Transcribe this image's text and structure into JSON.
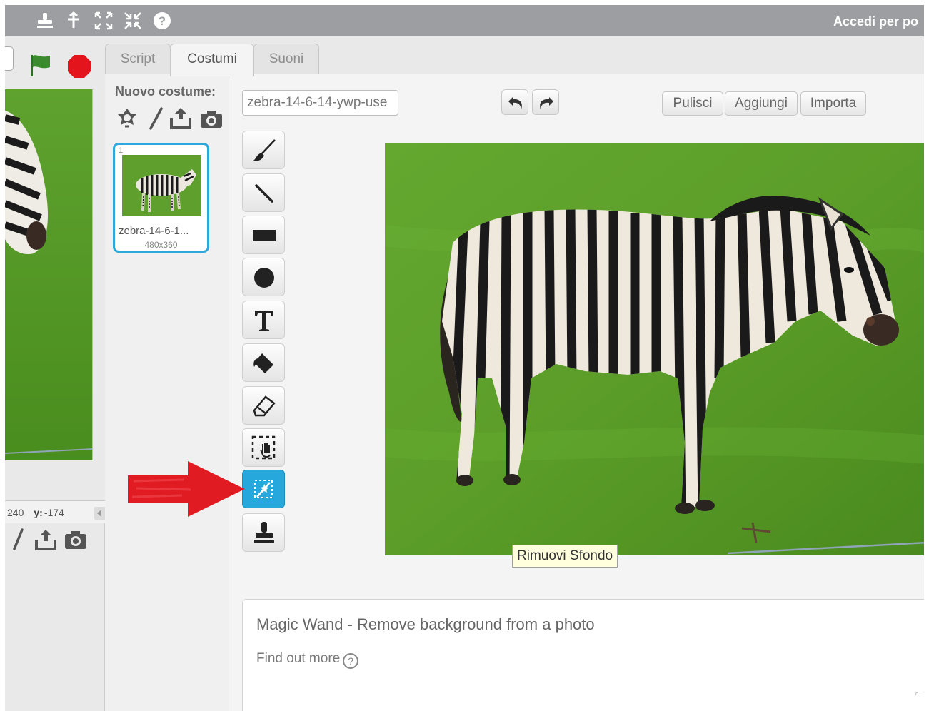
{
  "topbar": {
    "icons": [
      "stamp-icon",
      "scissors-grow-icon",
      "expand-icon",
      "shrink-icon",
      "help-icon"
    ],
    "login_label": "Accedi per po"
  },
  "stage": {
    "coords": {
      "x_value": "240",
      "y_label": "y:",
      "y_value": "-174"
    }
  },
  "tabs": [
    {
      "label": "Script",
      "active": false
    },
    {
      "label": "Costumi",
      "active": true
    },
    {
      "label": "Suoni",
      "active": false
    }
  ],
  "costumes_panel": {
    "new_costume_label": "Nuovo costume:",
    "new_costume_icons": [
      "sprite-library-icon",
      "paint-icon",
      "upload-icon",
      "camera-icon"
    ],
    "items": [
      {
        "index": "1",
        "name": "zebra-14-6-1...",
        "size": "480x360",
        "selected": true
      }
    ]
  },
  "editor": {
    "costume_name_value": "zebra-14-6-14-ywp-use",
    "buttons": {
      "clear": "Pulisci",
      "add": "Aggiungi",
      "import": "Importa"
    },
    "tools": [
      "brush-icon",
      "line-icon",
      "rectangle-icon",
      "ellipse-icon",
      "text-icon",
      "fill-icon",
      "eraser-icon",
      "select-icon",
      "magic-wand-icon",
      "stamp-icon"
    ],
    "active_tool": "magic-wand-icon",
    "tooltip": "Rimuovi Sfondo",
    "info": {
      "title": "Magic Wand - Remove background from a photo",
      "link": "Find out more"
    }
  },
  "colors": {
    "topbar": "#9c9ea2",
    "accent_blue": "#27a8dd",
    "green_flag": "#3b8a2e",
    "stop": "#e3141b",
    "arrow": "#e11b22"
  }
}
